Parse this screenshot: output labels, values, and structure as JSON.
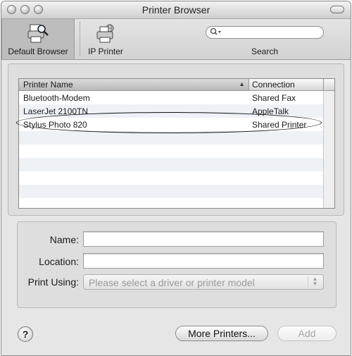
{
  "window": {
    "title": "Printer Browser"
  },
  "toolbar": {
    "items": [
      {
        "label": "Default Browser",
        "icon": "printer-magnifier-icon",
        "selected": true
      },
      {
        "label": "IP Printer",
        "icon": "network-printer-icon",
        "selected": false
      }
    ],
    "search": {
      "label": "Search",
      "value": "",
      "placeholder": ""
    }
  },
  "printer_list": {
    "columns": [
      "Printer Name",
      "Connection"
    ],
    "sort_indicator": "▲",
    "rows": [
      {
        "name": "Bluetooth-Modem",
        "connection": "Shared Fax"
      },
      {
        "name": "LaserJet 2100TN",
        "connection": "AppleTalk"
      },
      {
        "name": "Stylus Photo 820",
        "connection": "Shared Printer",
        "circled": true
      }
    ]
  },
  "details": {
    "name_label": "Name:",
    "name_value": "",
    "location_label": "Location:",
    "location_value": "",
    "print_using_label": "Print Using:",
    "print_using_value": "Please select a driver or printer model"
  },
  "buttons": {
    "help": "?",
    "more_printers": "More Printers...",
    "add": "Add"
  }
}
